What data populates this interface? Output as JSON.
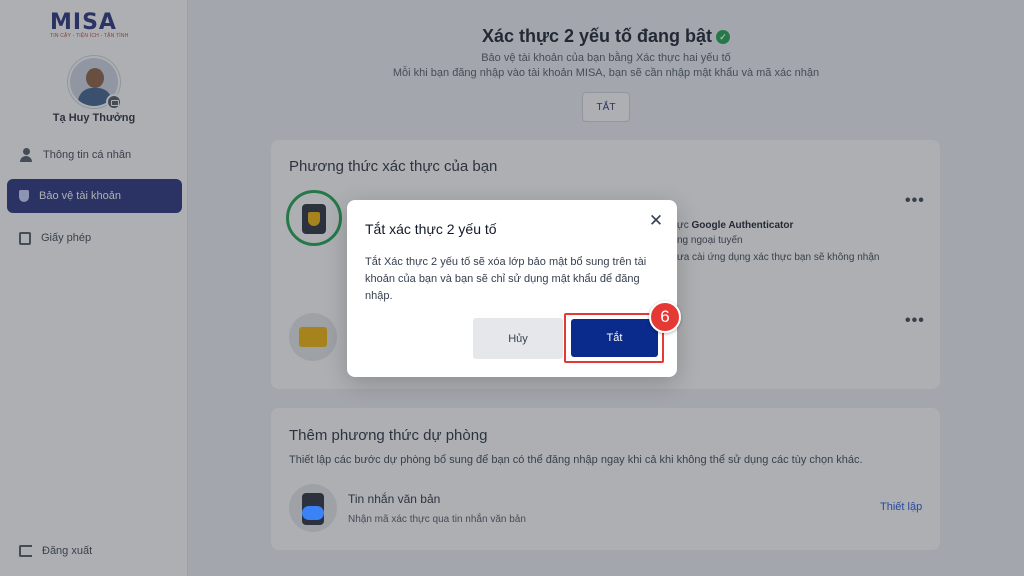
{
  "brand": {
    "name": "MISA",
    "tagline": "TIN CẬY - TIỆN ÍCH - TẬN TÌNH"
  },
  "user": {
    "name": "Tạ Huy Thưởng"
  },
  "sidebar": {
    "items": [
      {
        "label": "Thông tin cá nhân"
      },
      {
        "label": "Bảo vệ tài khoản"
      },
      {
        "label": "Giấy phép"
      }
    ],
    "logout": "Đăng xuất"
  },
  "header": {
    "title": "Xác thực 2 yếu tố đang bật",
    "line1": "Bảo vệ tài khoản của bạn bằng Xác thực hai yếu tố",
    "line2": "Mỗi khi bạn đăng nhập vào tài khoản MISA, bạn sẽ cần nhập mật khẩu và mã xác nhận",
    "off_button": "TẮT"
  },
  "methods_card": {
    "title": "Phương thức xác thực của bạn",
    "authenticator": {
      "line1_prefix": "ực",
      "line1_bold": "Google Authenticator",
      "line2": "ng ngoại tuyến",
      "line3": "ưa cài ứng dụng xác thực bạn sẽ không nhận"
    }
  },
  "backup_card": {
    "title": "Thêm phương thức dự phòng",
    "description": "Thiết lập các bước dự phòng bổ sung để bạn có thể đăng nhập ngay khi cả khi không thể sử dụng các tùy chọn khác.",
    "sms": {
      "title": "Tin nhắn văn bản",
      "description": "Nhận mã xác thực qua tin nhắn văn bản",
      "action": "Thiết lập"
    }
  },
  "modal": {
    "title": "Tắt xác thực 2 yếu tố",
    "body": "Tắt Xác thực 2 yếu tố sẽ xóa lớp bảo mật bổ sung trên tài khoản của bạn và bạn sẽ chỉ sử dụng mật khẩu để đăng nhập.",
    "cancel": "Hủy",
    "confirm": "Tắt",
    "close_glyph": "✕"
  },
  "step_badge": "6",
  "colors": {
    "primary": "#1e2a78",
    "confirm": "#0a2a8c",
    "highlight": "#e53935",
    "success": "#16a34a"
  }
}
